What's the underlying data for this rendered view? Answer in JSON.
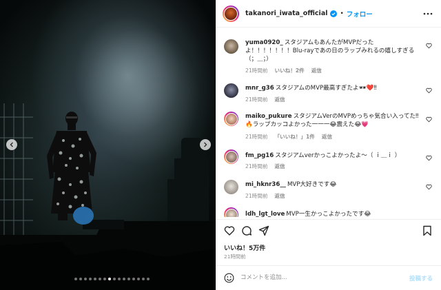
{
  "post": {
    "username": "takanori_iwata_official",
    "follow_label": "フォロー",
    "separator": "•"
  },
  "photo": {
    "carousel_count": 16,
    "carousel_active_index": 7
  },
  "comments": [
    {
      "user": "yuma0920_",
      "text": "スタジアムもあんたがMVPだったよ！！！！！！！Blu-rayであの日のラップみれるの嬉しすぎる（；＿；）",
      "time": "21時間前",
      "likes": "いいね！2件",
      "reply": "返信"
    },
    {
      "user": "mnr_g36",
      "text": "スタジアムのMVP最高すぎたよ🕶❤️‼",
      "time": "21時間前",
      "likes": "",
      "reply": "返信"
    },
    {
      "user": "maiko_pukure",
      "text": "スタジアムVerのMVPめっちゃ気合い入ってた‼🔥ラップカッコよかった一一一😂震えた😂💗",
      "time": "21時間前",
      "likes": "「いいね！」1件",
      "reply": "返信"
    },
    {
      "user": "fm_pg16",
      "text": "スタジアムverかっこよかったよ〜（ ｉ＿ｉ ）",
      "time": "21時間前",
      "likes": "",
      "reply": "返信"
    },
    {
      "user": "mi_hknr36__",
      "text": "MVP大好きです😂",
      "time": "21時間前",
      "likes": "",
      "reply": "返信"
    },
    {
      "user": "ldh_lgt_love",
      "text": "MVP一生かっこよかったです😂",
      "time": "",
      "likes": "",
      "reply": ""
    }
  ],
  "footer": {
    "likes_total": "いいね！5万件",
    "time": "21時間前",
    "comment_placeholder": "コメントを追加...",
    "post_label": "投稿する"
  },
  "icons": {
    "heart": "heart-icon",
    "comment": "comment-icon",
    "share": "share-icon",
    "save": "bookmark-icon",
    "emoji": "emoji-icon",
    "more": "more-options-icon",
    "verified": "verified-badge-icon"
  },
  "colors": {
    "accent": "#0095f6",
    "post_disabled": "#b2dffc",
    "muted": "#8e8e8e"
  }
}
